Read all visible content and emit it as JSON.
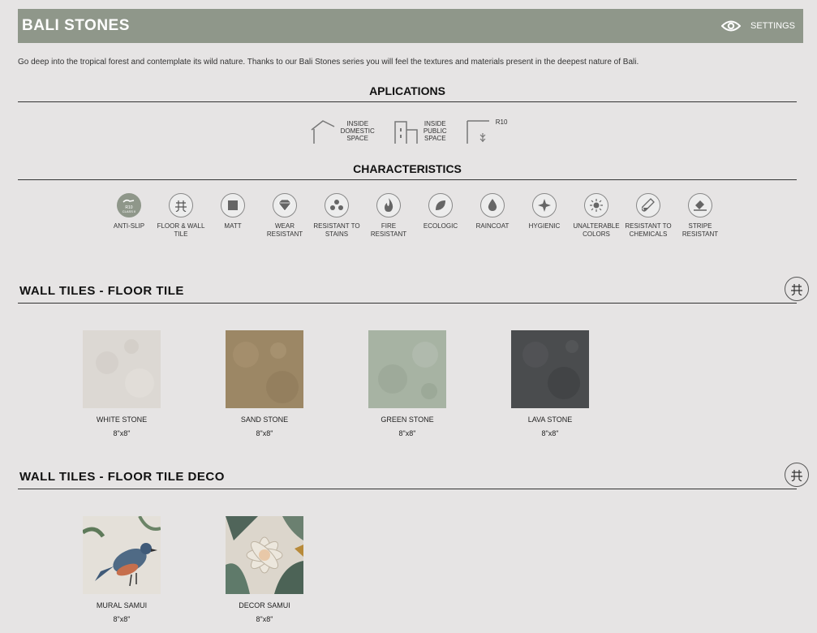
{
  "header": {
    "title": "BALI STONES",
    "settings_label": "SETTINGS"
  },
  "intro": "Go deep into the tropical forest and contemplate its wild nature. Thanks to our Bali Stones series you will feel the textures and materials present in the deepest nature of Bali.",
  "applications": {
    "heading": "APLICATIONS",
    "items": [
      {
        "icon": "house-icon",
        "label1": "INSIDE",
        "label2": "DOMESTIC",
        "label3": "SPACE"
      },
      {
        "icon": "building-icon",
        "label1": "INSIDE",
        "label2": "PUBLIC",
        "label3": "SPACE"
      },
      {
        "icon": "slip-rating-icon",
        "label1": "R10",
        "label2": "",
        "label3": ""
      }
    ]
  },
  "characteristics": {
    "heading": "CHARACTERISTICS",
    "items": [
      {
        "icon": "anti-slip-icon",
        "l1": "ANTI-SLIP",
        "l2": ""
      },
      {
        "icon": "floor-wall-icon",
        "l1": "FLOOR & WALL",
        "l2": "TILE"
      },
      {
        "icon": "matt-icon",
        "l1": "MATT",
        "l2": ""
      },
      {
        "icon": "diamond-icon",
        "l1": "WEAR RESISTANT",
        "l2": ""
      },
      {
        "icon": "stains-icon",
        "l1": "RESISTANT TO",
        "l2": "STAINS"
      },
      {
        "icon": "flame-icon",
        "l1": "FIRE RESISTANT",
        "l2": ""
      },
      {
        "icon": "leaf-icon",
        "l1": "ECOLOGIC",
        "l2": ""
      },
      {
        "icon": "drop-icon",
        "l1": "RAINCOAT",
        "l2": ""
      },
      {
        "icon": "sparkle-icon",
        "l1": "HYGIENIC",
        "l2": ""
      },
      {
        "icon": "sun-icon",
        "l1": "UNALTERABLE",
        "l2": "COLORS"
      },
      {
        "icon": "flask-icon",
        "l1": "RESISTANT TO",
        "l2": "CHEMICALS"
      },
      {
        "icon": "stripe-icon",
        "l1": "STRIPE",
        "l2": "RESISTANT"
      }
    ],
    "anti_slip_badge1": "R10",
    "anti_slip_badge2": "CLASS II"
  },
  "floor_tile": {
    "heading": "WALL TILES - FLOOR TILE",
    "items": [
      {
        "name": "WHITE STONE",
        "size": "8\"x8\"",
        "color": "#dcd8d3"
      },
      {
        "name": "SAND STONE",
        "size": "8\"x8\"",
        "color": "#9c8765"
      },
      {
        "name": "GREEN STONE",
        "size": "8\"x8\"",
        "color": "#a7b3a3"
      },
      {
        "name": "LAVA STONE",
        "size": "8\"x8\"",
        "color": "#4a4c4e"
      }
    ]
  },
  "deco_tile": {
    "heading": "WALL TILES - FLOOR TILE DECO",
    "items": [
      {
        "name": "MURAL SAMUI",
        "size": "8\"x8\""
      },
      {
        "name": "DECOR SAMUI",
        "size": "8\"x8\""
      }
    ]
  },
  "colors": {
    "header_bg": "#8f978a",
    "page_bg": "#e6e4e4"
  }
}
